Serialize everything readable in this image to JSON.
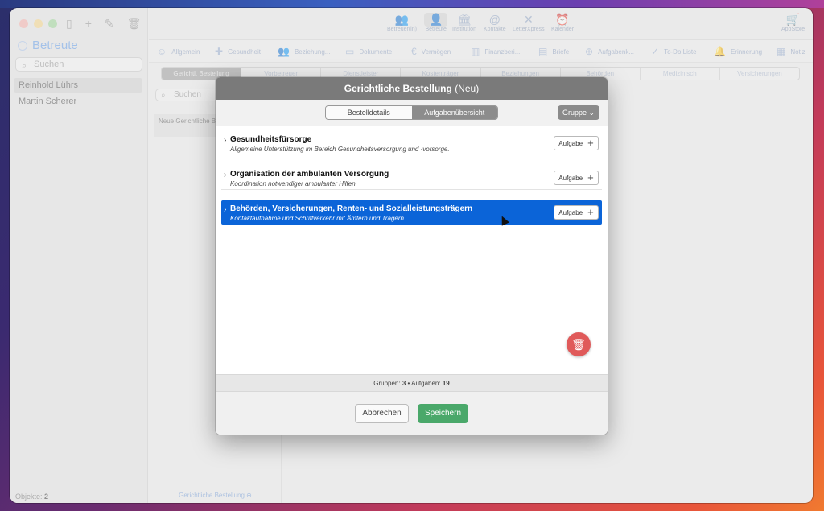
{
  "sidebar": {
    "title": "Betreute",
    "search_placeholder": "Suchen",
    "items": [
      {
        "label": "Reinhold Lührs"
      },
      {
        "label": "Martin Scherer"
      }
    ],
    "footer_label": "Objekte:",
    "footer_count": "2"
  },
  "toolbar": {
    "items": [
      {
        "label": "Betreuer(in)",
        "icon": "people-icon"
      },
      {
        "label": "Betreute",
        "icon": "person-icon"
      },
      {
        "label": "Institution",
        "icon": "building-icon"
      },
      {
        "label": "Kontakte",
        "icon": "at-icon"
      },
      {
        "label": "LetterXpress",
        "icon": "letter-icon"
      },
      {
        "label": "Kalender",
        "icon": "clock-icon"
      }
    ],
    "appstore_label": "AppStore"
  },
  "subtabs": [
    {
      "label": "Allgemein"
    },
    {
      "label": "Gesundheit"
    },
    {
      "label": "Beziehung..."
    },
    {
      "label": "Dokumente"
    },
    {
      "label": "Vermögen"
    },
    {
      "label": "Finanzberi..."
    },
    {
      "label": "Briefe"
    },
    {
      "label": "Aufgabenk..."
    },
    {
      "label": "To-Do Liste"
    },
    {
      "label": "Erinnerung"
    },
    {
      "label": "Notiz"
    }
  ],
  "segments": [
    {
      "label": "Gerichtl. Bestellung"
    },
    {
      "label": "Vorbetreuer"
    },
    {
      "label": "Dienstleister"
    },
    {
      "label": "Kostenträger"
    },
    {
      "label": "Beziehungen"
    },
    {
      "label": "Behörden"
    },
    {
      "label": "Medizinisch"
    },
    {
      "label": "Versicherungen"
    }
  ],
  "middle": {
    "search_placeholder": "Suchen",
    "card_label": "Neue Gerichtliche B",
    "footer_label": "Gerichtliche Bestellung"
  },
  "modal": {
    "title": "Gerichtliche Bestellung",
    "title_suffix": "(Neu)",
    "tabs": [
      {
        "label": "Bestelldetails"
      },
      {
        "label": "Aufgabenübersicht"
      }
    ],
    "group_button": "Gruppe ⌄",
    "groups": [
      {
        "title": "Gesundheitsfürsorge",
        "subtitle": "Allgemeine Unterstützung im Bereich Gesundheitsversorgung und -vorsorge."
      },
      {
        "title": "Organisation der ambulanten Versorgung",
        "subtitle": "Koordination notwendiger ambulanter Hilfen."
      },
      {
        "title": "Behörden, Versicherungen, Renten- und Sozialleistungsträgern",
        "subtitle": "Kontaktaufnahme und Schriftverkehr mit Ämtern und Trägern."
      }
    ],
    "add_task_label": "Aufgabe",
    "status_groups_label": "Gruppen:",
    "status_groups_value": "3",
    "status_sep": "•",
    "status_tasks_label": "Aufgaben:",
    "status_tasks_value": "19",
    "cancel_label": "Abbrechen",
    "save_label": "Speichern"
  },
  "colors": {
    "accent": "#0b64d8",
    "save": "#4aa86a",
    "delete": "#e05a5a"
  }
}
